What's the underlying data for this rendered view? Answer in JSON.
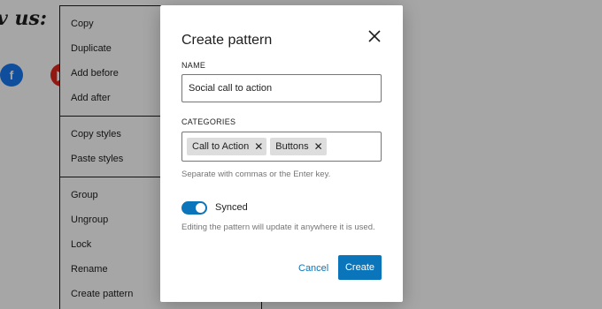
{
  "background": {
    "heading": "v us:",
    "social_icons": [
      {
        "name": "facebook-icon",
        "glyph": "f",
        "color": "#1877f2"
      },
      {
        "name": "youtube-icon",
        "glyph": "▶",
        "color": "#e1261c"
      }
    ],
    "menu_groups": [
      {
        "items": [
          {
            "label": "Copy"
          },
          {
            "label": "Duplicate"
          },
          {
            "label": "Add before"
          },
          {
            "label": "Add after"
          }
        ]
      },
      {
        "items": [
          {
            "label": "Copy styles"
          },
          {
            "label": "Paste styles"
          }
        ]
      },
      {
        "items": [
          {
            "label": "Group"
          },
          {
            "label": "Ungroup"
          },
          {
            "label": "Lock"
          },
          {
            "label": "Rename"
          },
          {
            "label": "Create pattern"
          }
        ]
      }
    ]
  },
  "modal": {
    "title": "Create pattern",
    "name_label": "NAME",
    "name_value": "Social call to action",
    "categories_label": "CATEGORIES",
    "categories": [
      "Call to Action",
      "Buttons"
    ],
    "categories_help": "Separate with commas or the Enter key.",
    "synced_label": "Synced",
    "synced": true,
    "synced_help": "Editing the pattern will update it anywhere it is used.",
    "cancel_label": "Cancel",
    "create_label": "Create"
  },
  "colors": {
    "accent": "#0a75ba",
    "overlay": "rgba(0,0,0,0.35)"
  }
}
